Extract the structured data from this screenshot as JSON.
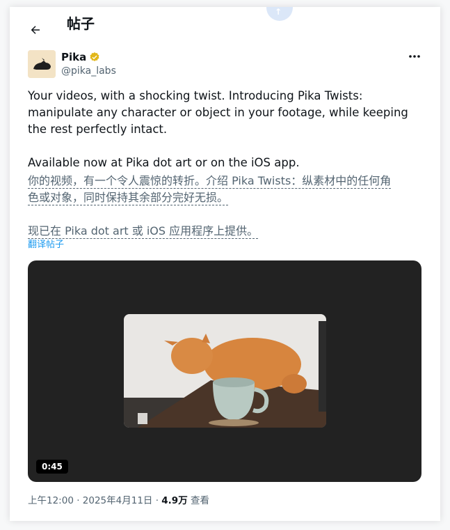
{
  "header": {
    "title": "帖子"
  },
  "author": {
    "name": "Pika",
    "handle": "@pika_labs"
  },
  "tweet": {
    "text": "Your videos, with a shocking twist. Introducing Pika Twists: manipulate any character or object in your footage, while keeping the rest perfectly intact.\n\nAvailable now at Pika dot art or on the iOS app.",
    "translation_line1": "你的视频，有一个令人震惊的转折。介绍 Pika Twists：纵素材中的任何角",
    "translation_line2": "色或对象，同时保持其余部分完好无损。",
    "translation_line3": "现已在 Pika dot art 或 iOS 应用程序上提供。",
    "translate_link": "翻译帖子"
  },
  "video": {
    "duration": "0:45"
  },
  "meta": {
    "time_date": "上午12:00 · 2025年4月11日 · ",
    "views_count": "4.9万",
    "views_label": " 查看"
  },
  "colors": {
    "accent": "#1d9bf0",
    "verified": "#e2b719",
    "video_bg": "#222222"
  },
  "icons": [
    "back-arrow-icon",
    "verified-badge-icon",
    "more-icon"
  ]
}
